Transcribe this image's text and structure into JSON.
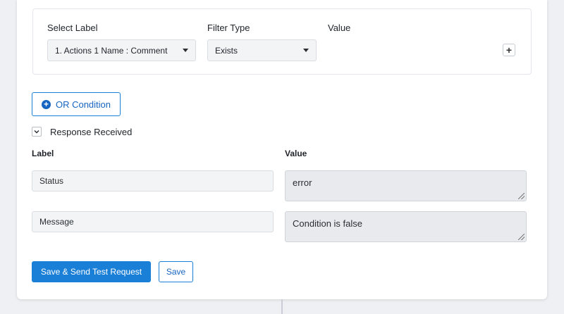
{
  "filter": {
    "select_label_header": "Select Label",
    "filter_type_header": "Filter Type",
    "value_header": "Value",
    "selected_label": "1. Actions 1 Name : Comment",
    "selected_filter_type": "Exists",
    "add_icon": "plus-icon"
  },
  "or_condition": {
    "label": "OR Condition",
    "icon": "plus-circle-icon"
  },
  "response": {
    "title": "Response Received",
    "toggle_icon": "chevron-down-icon",
    "label_header": "Label",
    "value_header": "Value",
    "rows": [
      {
        "label": "Status",
        "value": "error"
      },
      {
        "label": "Message",
        "value": "Condition is false"
      }
    ]
  },
  "actions": {
    "save_send_label": "Save & Send Test Request",
    "save_label": "Save"
  },
  "colors": {
    "primary": "#1a7fd6",
    "background": "#eef0f3",
    "field_bg": "#f2f4f6",
    "value_bg": "#e8eaed"
  }
}
